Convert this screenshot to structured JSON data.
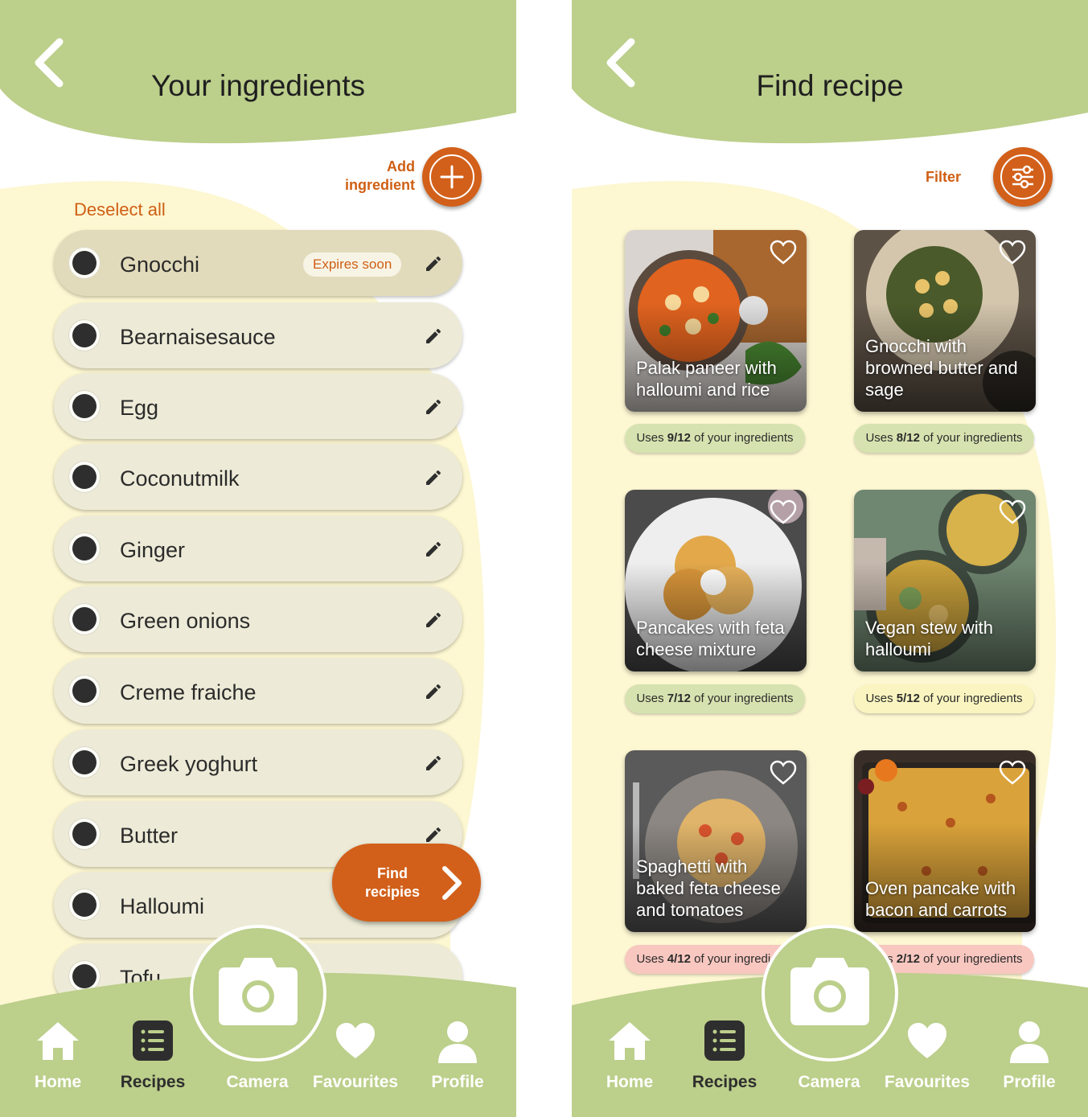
{
  "colors": {
    "header_green": "#bccf8b",
    "cream_blob": "#fdf7d2",
    "accent_orange": "#d2601a",
    "row_bg": "#edebd7",
    "uses_green": "#d6e3b0",
    "uses_yellow": "#faf5c0",
    "uses_pink": "#f8c7c0"
  },
  "left": {
    "title": "Your ingredients",
    "add_ingredient_label": "Add ingredient",
    "deselect_all": "Deselect all",
    "ingredients": [
      {
        "name": "Gnocchi",
        "badge": "Expires soon",
        "selected": true
      },
      {
        "name": "Bearnaisesauce",
        "selected": true
      },
      {
        "name": "Egg",
        "selected": true
      },
      {
        "name": "Coconutmilk",
        "selected": true
      },
      {
        "name": "Ginger",
        "selected": true
      },
      {
        "name": "Green onions",
        "selected": true
      },
      {
        "name": "Creme fraiche",
        "selected": true
      },
      {
        "name": "Greek yoghurt",
        "selected": true
      },
      {
        "name": "Butter",
        "selected": true
      },
      {
        "name": "Halloumi",
        "selected": true
      },
      {
        "name": "Tofu",
        "selected": true
      }
    ],
    "find_recipes": "Find recipies"
  },
  "right": {
    "title": "Find recipe",
    "filter_label": "Filter",
    "recipes": [
      {
        "title": "Palak paneer with halloumi and rice",
        "uses_prefix": "Uses ",
        "uses_count": "9/12",
        "uses_suffix": " of your ingredients",
        "uses_color": "#d6e3b0",
        "photo": "curry"
      },
      {
        "title": "Gnocchi with browned butter and sage",
        "uses_prefix": "Uses ",
        "uses_count": "8/12",
        "uses_suffix": " of your ingredients",
        "uses_color": "#d6e3b0",
        "photo": "gnocchi"
      },
      {
        "title": "Pancakes with feta cheese mixture",
        "uses_prefix": "Uses ",
        "uses_count": "7/12",
        "uses_suffix": " of your ingredients",
        "uses_color": "#d6e3b0",
        "photo": "pancakes"
      },
      {
        "title": "Vegan stew with halloumi",
        "uses_prefix": "Uses ",
        "uses_count": "5/12",
        "uses_suffix": " of your ingredients",
        "uses_color": "#faf5c0",
        "photo": "stew"
      },
      {
        "title": "Spaghetti with baked feta cheese and tomatoes",
        "uses_prefix": "Uses ",
        "uses_count": "4/12",
        "uses_suffix": " of your ingredients",
        "uses_color": "#f8c7c0",
        "photo": "spaghetti"
      },
      {
        "title": "Oven pancake with bacon and carrots",
        "uses_prefix": "Uses ",
        "uses_count": "2/12",
        "uses_suffix": " of your ingredients",
        "uses_color": "#f8c7c0",
        "photo": "ovenpancake"
      }
    ]
  },
  "nav": {
    "items": [
      {
        "label": "Home",
        "icon": "home-icon"
      },
      {
        "label": "Recipes",
        "icon": "list-icon",
        "active": true
      },
      {
        "label": "Camera",
        "icon": "camera-icon"
      },
      {
        "label": "Favourites",
        "icon": "heart-icon"
      },
      {
        "label": "Profile",
        "icon": "profile-icon"
      }
    ]
  }
}
